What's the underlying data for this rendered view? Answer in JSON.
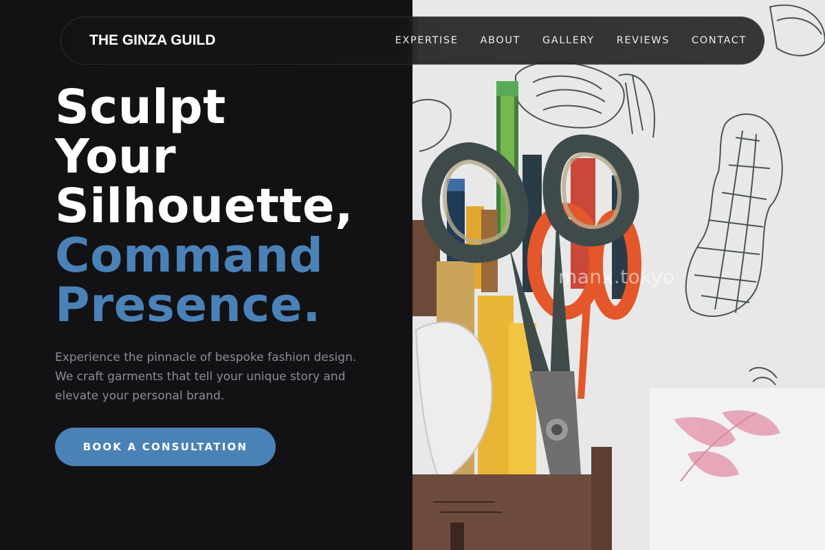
{
  "header": {
    "brand": "THE GINZA GUILD",
    "nav": [
      "EXPERTISE",
      "ABOUT",
      "GALLERY",
      "REVIEWS",
      "CONTACT"
    ]
  },
  "hero": {
    "headline_lines": [
      "Sculpt",
      "Your",
      "Silhouette,"
    ],
    "headline_accent_lines": [
      "Command",
      "Presence."
    ],
    "description": "Experience the pinnacle of bespoke fashion design. We craft garments that tell your unique story and elevate your personal brand.",
    "cta_label": "BOOK A CONSULTATION"
  },
  "image": {
    "subject": "photo-of-scissors-pencils-and-sketches",
    "watermark": "manx.tokyo"
  },
  "colors": {
    "background": "#121214",
    "accent": "#4a82b8",
    "text_primary": "#ffffff",
    "text_muted": "#8b8e96"
  }
}
